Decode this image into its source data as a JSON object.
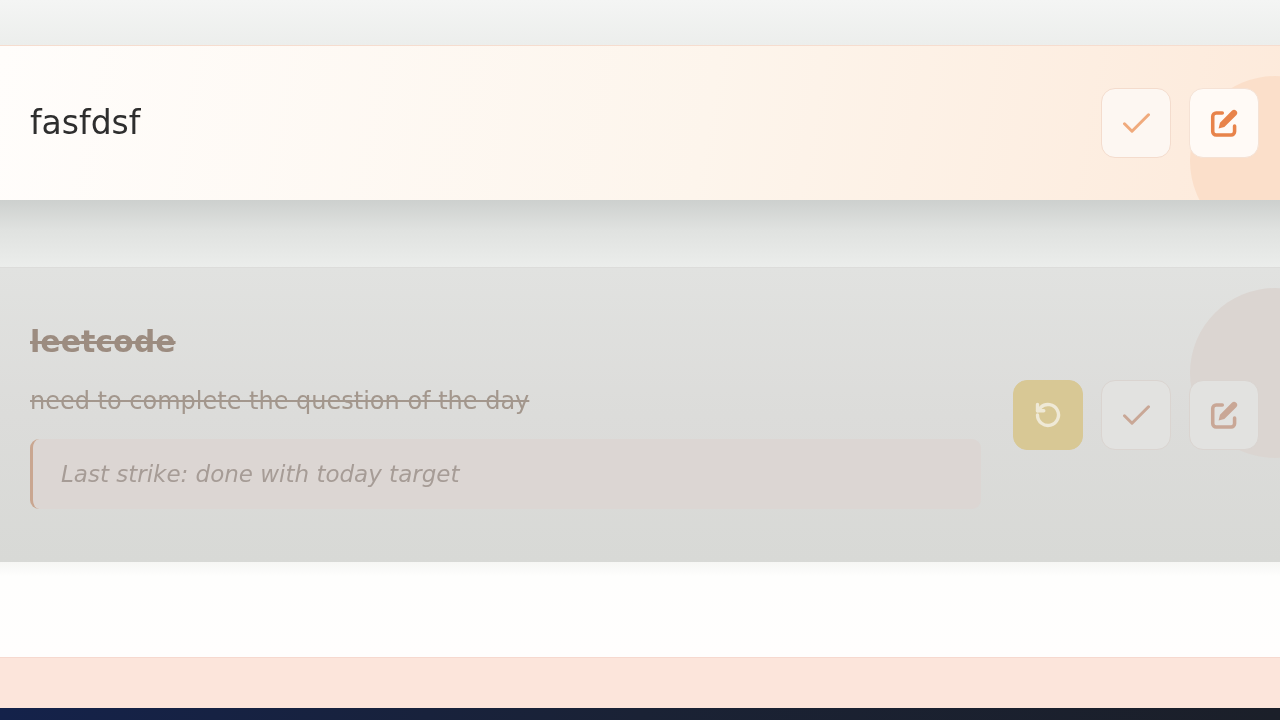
{
  "tasks": [
    {
      "title": "fasfdsf",
      "completed": false,
      "actions": [
        {
          "kind": "complete"
        },
        {
          "kind": "edit"
        }
      ]
    },
    {
      "title": "leetcode",
      "completed": true,
      "description": "need to complete the question of the day",
      "note": "Last strike: done with today target",
      "actions": [
        {
          "kind": "undo"
        },
        {
          "kind": "complete"
        },
        {
          "kind": "edit"
        }
      ]
    }
  ]
}
